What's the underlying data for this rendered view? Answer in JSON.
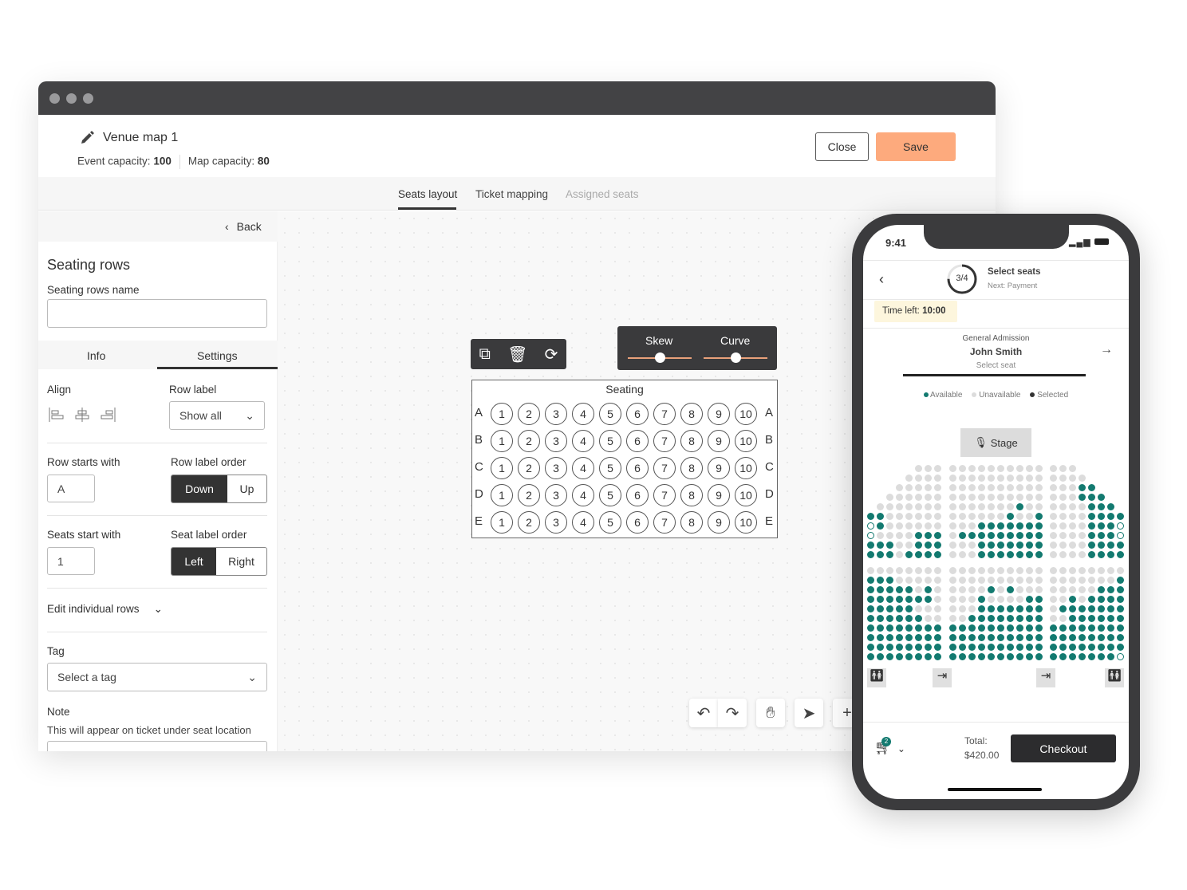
{
  "editor": {
    "title": "Venue map 1",
    "event_capacity_label": "Event capacity:",
    "event_capacity": "100",
    "map_capacity_label": "Map capacity:",
    "map_capacity": "80",
    "close_label": "Close",
    "save_label": "Save",
    "tabs": [
      {
        "label": "Seats layout",
        "active": true
      },
      {
        "label": "Ticket mapping"
      },
      {
        "label": "Assigned seats",
        "disabled": true
      }
    ],
    "colors": {
      "save": "#fdaa7d",
      "dark": "#333333",
      "slider": "#e8a07a"
    }
  },
  "panel": {
    "back": "Back",
    "heading": "Seating rows",
    "name_label": "Seating rows name",
    "name_value": "",
    "subtabs": [
      {
        "label": "Info"
      },
      {
        "label": "Settings",
        "active": true
      }
    ],
    "align_label": "Align",
    "row_label_label": "Row label",
    "row_label_value": "Show all",
    "row_starts_label": "Row starts with",
    "row_starts_value": "A",
    "row_order_label": "Row label order",
    "row_order": [
      "Down",
      "Up"
    ],
    "seats_start_label": "Seats start with",
    "seats_start_value": "1",
    "seat_order_label": "Seat label order",
    "seat_order": [
      "Left",
      "Right"
    ],
    "edit_rows": "Edit individual rows",
    "tag_label": "Tag",
    "tag_value": "Select a tag",
    "note_label": "Note",
    "note_help": "This will appear on ticket under seat location"
  },
  "canvas": {
    "skew_label": "Skew",
    "curve_label": "Curve",
    "skew_value": 0.5,
    "curve_value": 0.5,
    "block_title": "Seating",
    "rows": [
      "A",
      "B",
      "C",
      "D",
      "E"
    ],
    "seats": [
      "1",
      "2",
      "3",
      "4",
      "5",
      "6",
      "7",
      "8",
      "9",
      "10"
    ]
  },
  "phone": {
    "time": "9:41",
    "step": "3/4",
    "step_progress": 0.75,
    "step_title": "Select seats",
    "step_next": "Next: Payment",
    "timer_label": "Time left:",
    "timer_value": "10:00",
    "ticket_type": "General Admission",
    "attendee": "John Smith",
    "attendee_hint": "Select seat",
    "legend": [
      {
        "label": "Available",
        "color": "#137a70"
      },
      {
        "label": "Unavailable",
        "color": "#dcdcdc"
      },
      {
        "label": "Selected",
        "color": "#333333"
      }
    ],
    "stage_label": "Stage",
    "cart_count": "2",
    "total_label": "Total:",
    "total_value": "$420.00",
    "checkout_label": "Checkout",
    "seat_map_upper": [
      [
        "     ...",
        "..........",
        "...     "
      ],
      [
        "    ....",
        "..........",
        "....    "
      ],
      [
        "   .....",
        "..........",
        "...oo   "
      ],
      [
        "  ......",
        "..........",
        "...ooo  "
      ],
      [
        " .......",
        ".......o..",
        "....ooo "
      ],
      [
        "oo......",
        "......o..o",
        "....oooo"
      ],
      [
        "wo......",
        "...ooooooo",
        "....ooow"
      ],
      [
        "w....ooo",
        ".ooooooooo",
        "....ooow"
      ],
      [
        "ooo..ooo",
        "...ooooooo",
        "....oooo"
      ],
      [
        "ooo.oooo",
        "...ooooooo",
        "....oooo"
      ]
    ],
    "seat_map_lower": [
      [
        "........",
        "..........",
        "........"
      ],
      [
        "ooo.....",
        "..........",
        ".......o"
      ],
      [
        "ooooo.o.",
        "....o.o...",
        ".....ooo"
      ],
      [
        "ooooooo.",
        "...o....oo",
        "..o.oooo"
      ],
      [
        "ooooo...",
        "...ooooooo",
        ".ooooooo"
      ],
      [
        "oooooo..",
        "..oooooooo",
        "..oooooo"
      ],
      [
        "oooooooo",
        "oooooooooo",
        "oooooooo"
      ],
      [
        "oooooooo",
        "oooooooooo",
        "oooooooo"
      ],
      [
        "oooooooo",
        "oooooooooo",
        "oooooooo"
      ],
      [
        "oooooooo",
        "oooooooooo",
        "ooooooow"
      ]
    ]
  }
}
